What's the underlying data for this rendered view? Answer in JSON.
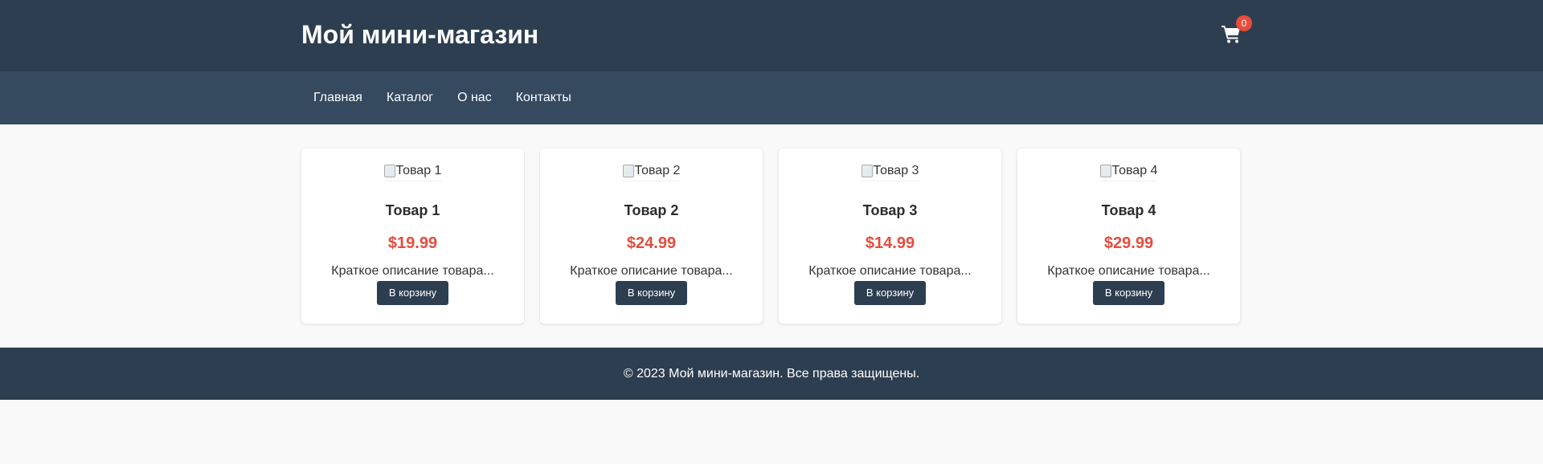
{
  "header": {
    "logo": "Мой мини-магазин",
    "cart_icon": "shopping-cart-icon",
    "cart_count": "0"
  },
  "nav": {
    "items": [
      {
        "label": "Главная"
      },
      {
        "label": "Каталог"
      },
      {
        "label": "О нас"
      },
      {
        "label": "Контакты"
      }
    ]
  },
  "products": [
    {
      "image_alt": "Товар 1",
      "title": "Товар 1",
      "price": "$19.99",
      "description": "Краткое описание товара...",
      "button": "В корзину"
    },
    {
      "image_alt": "Товар 2",
      "title": "Товар 2",
      "price": "$24.99",
      "description": "Краткое описание товара...",
      "button": "В корзину"
    },
    {
      "image_alt": "Товар 3",
      "title": "Товар 3",
      "price": "$14.99",
      "description": "Краткое описание товара...",
      "button": "В корзину"
    },
    {
      "image_alt": "Товар 4",
      "title": "Товар 4",
      "price": "$29.99",
      "description": "Краткое описание товара...",
      "button": "В корзину"
    }
  ],
  "footer": {
    "text": "© 2023 Мой мини-магазин. Все права защищены."
  },
  "colors": {
    "header_bg": "#2d3e50",
    "nav_bg": "#35495f",
    "accent": "#e74c3c",
    "page_bg": "#f9f9f9"
  }
}
